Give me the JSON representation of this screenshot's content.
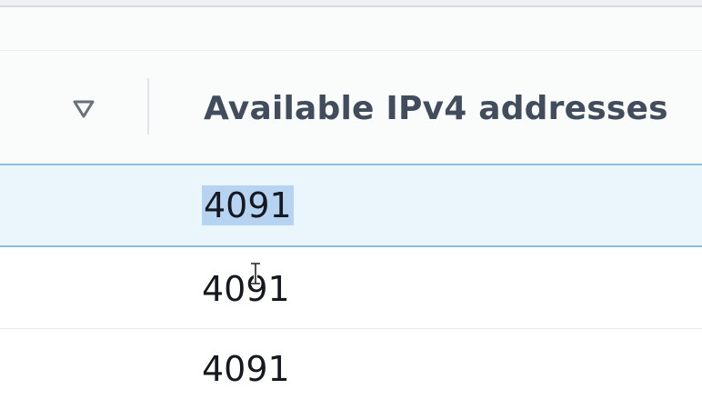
{
  "table": {
    "sort_icon": "sort-down-triangle-icon",
    "column_header": "Available IPv4 addresses",
    "rows": [
      {
        "available_ipv4": "4091",
        "selected": true
      },
      {
        "available_ipv4": "4091",
        "selected": false
      },
      {
        "available_ipv4": "4091",
        "selected": false
      }
    ]
  },
  "cursor": {
    "type": "i-beam-cursor-icon"
  },
  "colors": {
    "header_text": "#414d5c",
    "selected_row_bg": "#eaf5fc",
    "selected_row_border": "#8fbcdc",
    "text_selection": "#b6d4f2"
  }
}
